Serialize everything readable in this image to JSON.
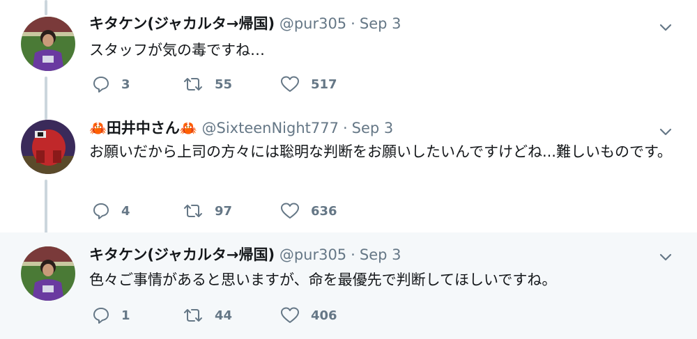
{
  "tweets": [
    {
      "name": "キタケン(ジャカルタ→帰国)",
      "handle": "@pur305",
      "separator": "·",
      "date": "Sep 3",
      "text": "スタッフが気の毒ですね…",
      "replies": "3",
      "retweets": "55",
      "likes": "517",
      "avatar": "soccer-fan-photo",
      "highlighted": false
    },
    {
      "name": "田井中さん",
      "name_prefix_icon": "crab-icon",
      "name_suffix_icon": "crab-icon",
      "handle": "@SixteenNight777",
      "separator": "·",
      "date": "Sep 3",
      "text": "お願いだから上司の方々には聡明な判断をお願いしたいんですけどね...難しいものです。",
      "replies": "4",
      "retweets": "97",
      "likes": "636",
      "avatar": "red-pixel-monster",
      "highlighted": false
    },
    {
      "name": "キタケン(ジャカルタ→帰国)",
      "handle": "@pur305",
      "separator": "·",
      "date": "Sep 3",
      "text": "色々ご事情があると思いますが、命を最優先で判断してほしいですね。",
      "replies": "1",
      "retweets": "44",
      "likes": "406",
      "avatar": "soccer-fan-photo",
      "highlighted": true
    }
  ],
  "colors": {
    "text": "#14171a",
    "secondary": "#657786",
    "thread_line": "#ccd6dd",
    "highlight_bg": "#f5f8fa",
    "crab": "#dd2e44"
  }
}
